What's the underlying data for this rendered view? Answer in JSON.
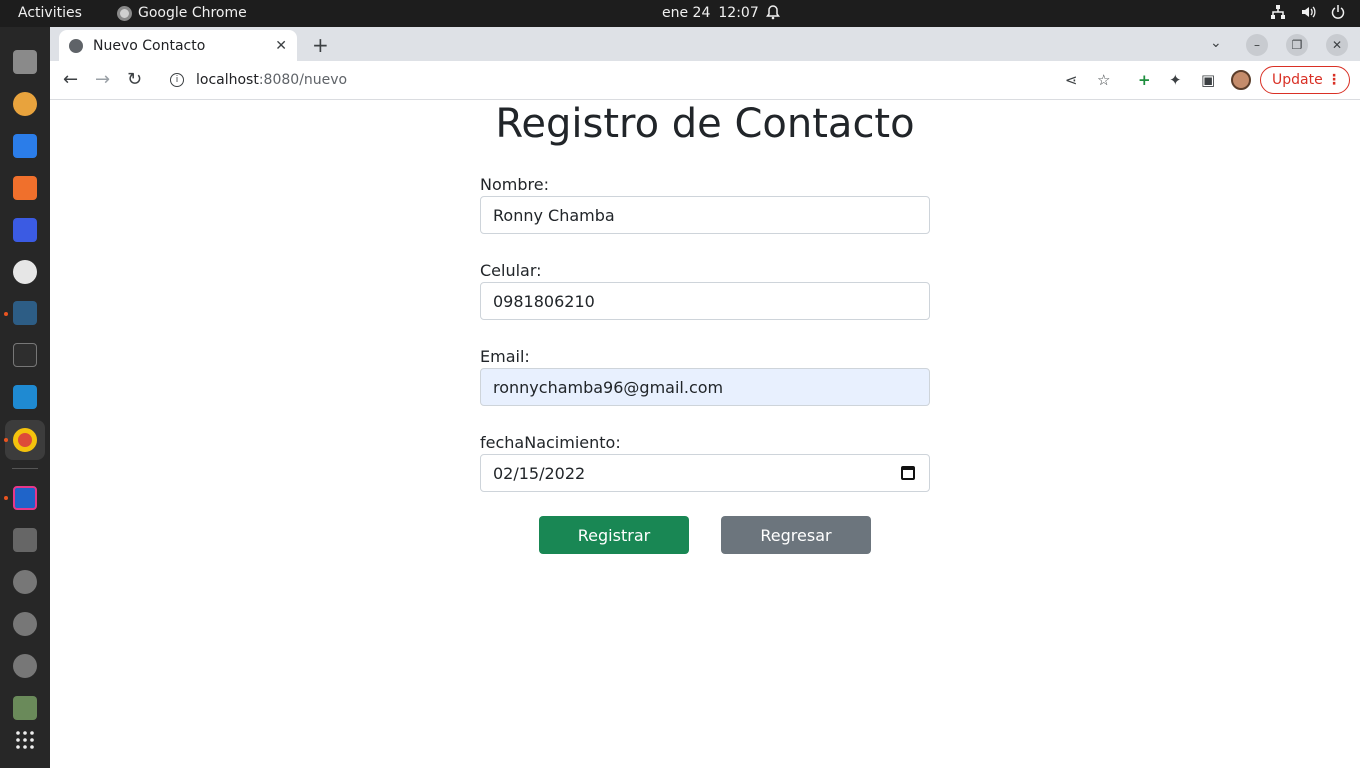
{
  "system_bar": {
    "activities": "Activities",
    "app_name": "Google Chrome",
    "date": "ene 24",
    "time": "12:07"
  },
  "browser": {
    "tab_title": "Nuevo Contacto",
    "url_host": "localhost",
    "url_path": ":8080/nuevo",
    "update_label": "Update"
  },
  "form": {
    "title": "Registro de Contacto",
    "fields": [
      {
        "label": "Nombre:",
        "value": "Ronny Chamba"
      },
      {
        "label": "Celular:",
        "value": "0981806210"
      },
      {
        "label": "Email:",
        "value": "ronnychamba96@gmail.com"
      },
      {
        "label": "fechaNacimiento:",
        "value": "02/15/2022"
      }
    ],
    "submit_label": "Registrar",
    "back_label": "Regresar"
  },
  "colors": {
    "submit_button": "#198754",
    "back_button": "#6c757d",
    "autofill_bg": "#e8f0fe",
    "update_accent": "#d93025"
  }
}
